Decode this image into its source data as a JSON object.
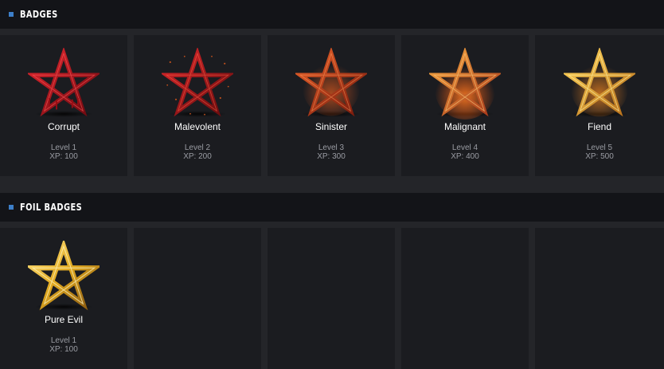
{
  "sections": [
    {
      "title": "BADGES",
      "badges": [
        {
          "name": "Corrupt",
          "level": "Level 1",
          "xp": "XP: 100",
          "icon": "red-pentagram-icon",
          "color": "#b3121c"
        },
        {
          "name": "Malevolent",
          "level": "Level 2",
          "xp": "XP: 200",
          "icon": "red-sparked-pentagram-icon",
          "color": "#b8181c"
        },
        {
          "name": "Sinister",
          "level": "Level 3",
          "xp": "XP: 300",
          "icon": "burning-pentagram-icon",
          "color": "#c2361a"
        },
        {
          "name": "Malignant",
          "level": "Level 4",
          "xp": "XP: 400",
          "icon": "fiery-pentagram-icon",
          "color": "#e0661a"
        },
        {
          "name": "Fiend",
          "level": "Level 5",
          "xp": "XP: 500",
          "icon": "gold-flame-pentagram-icon",
          "color": "#d99a25"
        }
      ]
    },
    {
      "title": "FOIL BADGES",
      "badges": [
        {
          "name": "Pure Evil",
          "level": "Level 1",
          "xp": "XP: 100",
          "icon": "gold-pentagram-icon",
          "color": "#e0a820"
        }
      ]
    }
  ],
  "colors": {
    "accent": "#3d7fc9",
    "header_bg": "#131418",
    "card_bg": "#1b1c20",
    "page_bg": "#242529"
  }
}
